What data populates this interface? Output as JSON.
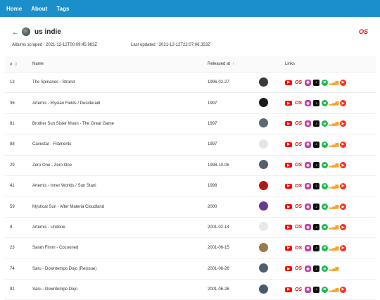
{
  "nav": {
    "home": "Home",
    "about": "About",
    "tags": "Tags"
  },
  "tag": {
    "back_icon": "arrow-left-icon",
    "name": "us indie",
    "lastfm_label": "OS"
  },
  "meta": {
    "scraped_label": "Albums scraped :",
    "scraped_value": "2021-12-12T00:09:45.983Z",
    "updated_label": "Last updated :",
    "updated_value": "2021-12-12T22:07:06.353Z"
  },
  "table": {
    "headers": {
      "num": "#",
      "name": "Name",
      "released": "Released at",
      "links": "Links"
    },
    "rows": [
      {
        "num": "13",
        "name": "The Spinanes - Strand",
        "released": "1996-02-27",
        "cover": "#3a3a3a"
      },
      {
        "num": "36",
        "name": "Artemis - Elysian Fields / Desideradi",
        "released": "1997",
        "cover": "#1a1a1a"
      },
      {
        "num": "81",
        "name": "Brother Sun Sister Moon - The Great Game",
        "released": "1997",
        "cover": "#5a6a70"
      },
      {
        "num": "88",
        "name": "Cavestar - Filaments",
        "released": "1997",
        "cover": "#e3e5e6"
      },
      {
        "num": "29",
        "name": "Zero One - Zero One",
        "released": "1998-10-06",
        "cover": "#55606a"
      },
      {
        "num": "41",
        "name": "Artemis - Inner Worlds / Sun Stani",
        "released": "1998",
        "cover": "#b01818"
      },
      {
        "num": "59",
        "name": "Mystical Sun - After Materia Cloudland",
        "released": "2000",
        "cover": "#6a3a8a"
      },
      {
        "num": "9",
        "name": "Artemis - Undone",
        "released": "2001-02-14",
        "cover": "#e8e8e8"
      },
      {
        "num": "23",
        "name": "Sarah Fimm - Cocooned",
        "released": "2001-06-15",
        "cover": "#9a7a50"
      },
      {
        "num": "74",
        "name": "Saru - Downtempo Dojo (Reissue)",
        "released": "2001-06-26",
        "cover": "#506070"
      },
      {
        "num": "91",
        "name": "Saru - Downtempo Dojo",
        "released": "2001-06-26",
        "cover": "#4a5a68"
      }
    ],
    "link_icons": [
      "youtube-icon",
      "lastfm-icon",
      "podcast-icon",
      "apple-music-icon",
      "spotify-icon",
      "deezer-icon",
      "youtube-music-icon"
    ],
    "lastfm_text": "OS",
    "deezer_text": "▂▄▆"
  }
}
